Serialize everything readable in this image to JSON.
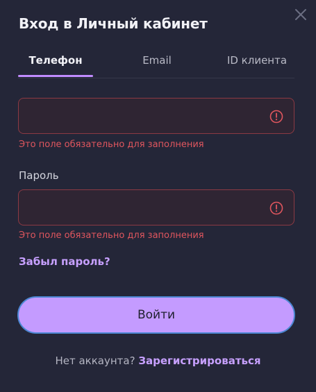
{
  "modal": {
    "title": "Вход в Личный кабинет",
    "close_icon": "close-icon"
  },
  "tabs": [
    {
      "label": "Телефон",
      "active": true
    },
    {
      "label": "Email",
      "active": false
    },
    {
      "label": "ID клиента",
      "active": false
    }
  ],
  "phone_field": {
    "value": "",
    "placeholder": "",
    "error": "Это поле обязательно для заполнения",
    "icon": "warning-icon"
  },
  "password_field": {
    "label": "Пароль",
    "value": "",
    "placeholder": "",
    "error": "Это поле обязательно для заполнения",
    "icon": "warning-icon"
  },
  "forgot_password": "Забыл пароль?",
  "login_button": "Войти",
  "footer": {
    "text": "Нет аккаунта?",
    "register_link": "Зарегистрироваться"
  },
  "colors": {
    "background": "#242638",
    "accent": "#c49bff",
    "error": "#e0565e",
    "link": "#c7a0ff"
  }
}
